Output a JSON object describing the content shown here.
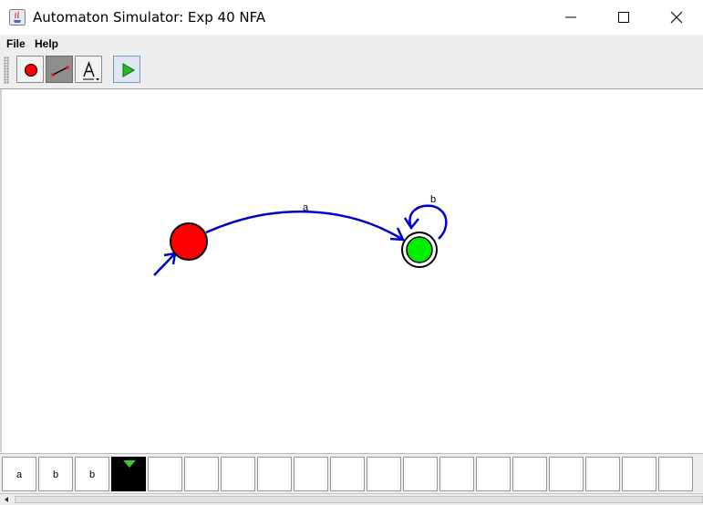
{
  "window": {
    "title": "Automaton Simulator: Exp 40 NFA",
    "controls": [
      "minimize",
      "maximize",
      "close"
    ]
  },
  "menu": {
    "items": [
      "File",
      "Help"
    ]
  },
  "toolbar": {
    "tools": [
      {
        "name": "add-state",
        "icon": "red-circle-icon"
      },
      {
        "name": "add-transition",
        "icon": "transition-line-icon",
        "selected": true
      },
      {
        "name": "add-label",
        "icon": "text-a-icon"
      },
      {
        "name": "run",
        "icon": "play-icon"
      }
    ]
  },
  "automaton": {
    "states": [
      {
        "id": "q0",
        "initial": true,
        "accepting": false,
        "color": "#ff0000"
      },
      {
        "id": "q1",
        "initial": false,
        "accepting": true,
        "color": "#00ee00"
      }
    ],
    "transitions": [
      {
        "from": "q0",
        "to": "q1",
        "label": "a"
      },
      {
        "from": "q1",
        "to": "q1",
        "label": "b"
      }
    ],
    "edge_color": "#0000cc"
  },
  "tape": {
    "cells": [
      "a",
      "b",
      "b",
      "",
      "",
      "",
      "",
      "",
      "",
      "",
      "",
      "",
      "",
      "",
      "",
      "",
      "",
      "",
      ""
    ],
    "head_index": 3,
    "head_marker_color": "#33cc33"
  }
}
